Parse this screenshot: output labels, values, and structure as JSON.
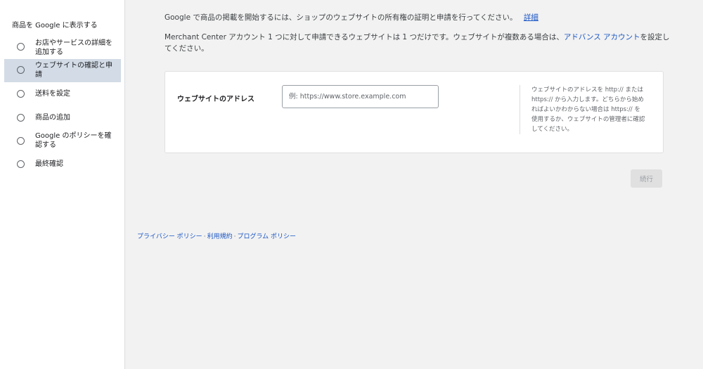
{
  "sidebar": {
    "title": "商品を Google に表示する",
    "steps": [
      {
        "line1": "お店やサービスの詳細を",
        "line2": "追加する"
      },
      {
        "line1": "ウェブサイトの確認と申",
        "line2": "請"
      },
      {
        "line1": "送料を設定",
        "line2": ""
      },
      {
        "line1": "商品の追加",
        "line2": ""
      },
      {
        "line1": "Google のポリシーを確",
        "line2": "認する"
      },
      {
        "line1": "最終確認",
        "line2": ""
      }
    ]
  },
  "main": {
    "intro_text": "Google で商品の掲載を開始するには、ショップのウェブサイトの所有権の証明と申請を行ってください。",
    "intro_link": "詳細",
    "account_text_before": "Merchant Center アカウント 1 つに対して申請できるウェブサイトは 1 つだけです。ウェブサイトが複数ある場合は、",
    "account_link": "アドバンス アカウント",
    "account_text_after": "を設定してください。",
    "website_field": {
      "label": "ウェブサイトのアドレス",
      "value": "",
      "placeholder": "例: https://www.store.example.com",
      "help": "ウェブサイトのアドレスを http:// または https:// から入力します。どちらから始めればよいかわからない場合は https:// を使用するか、ウェブサイトの管理者に確認してください。"
    },
    "continue_label": "続行"
  },
  "footer": {
    "privacy": "プライバシー ポリシー",
    "terms": "利用規約",
    "program": "プログラム ポリシー",
    "separator": "·"
  },
  "colors": {
    "link": "#1a56c5",
    "active_step_bg": "#d2dbe6",
    "page_bg": "#f2f2f2"
  }
}
